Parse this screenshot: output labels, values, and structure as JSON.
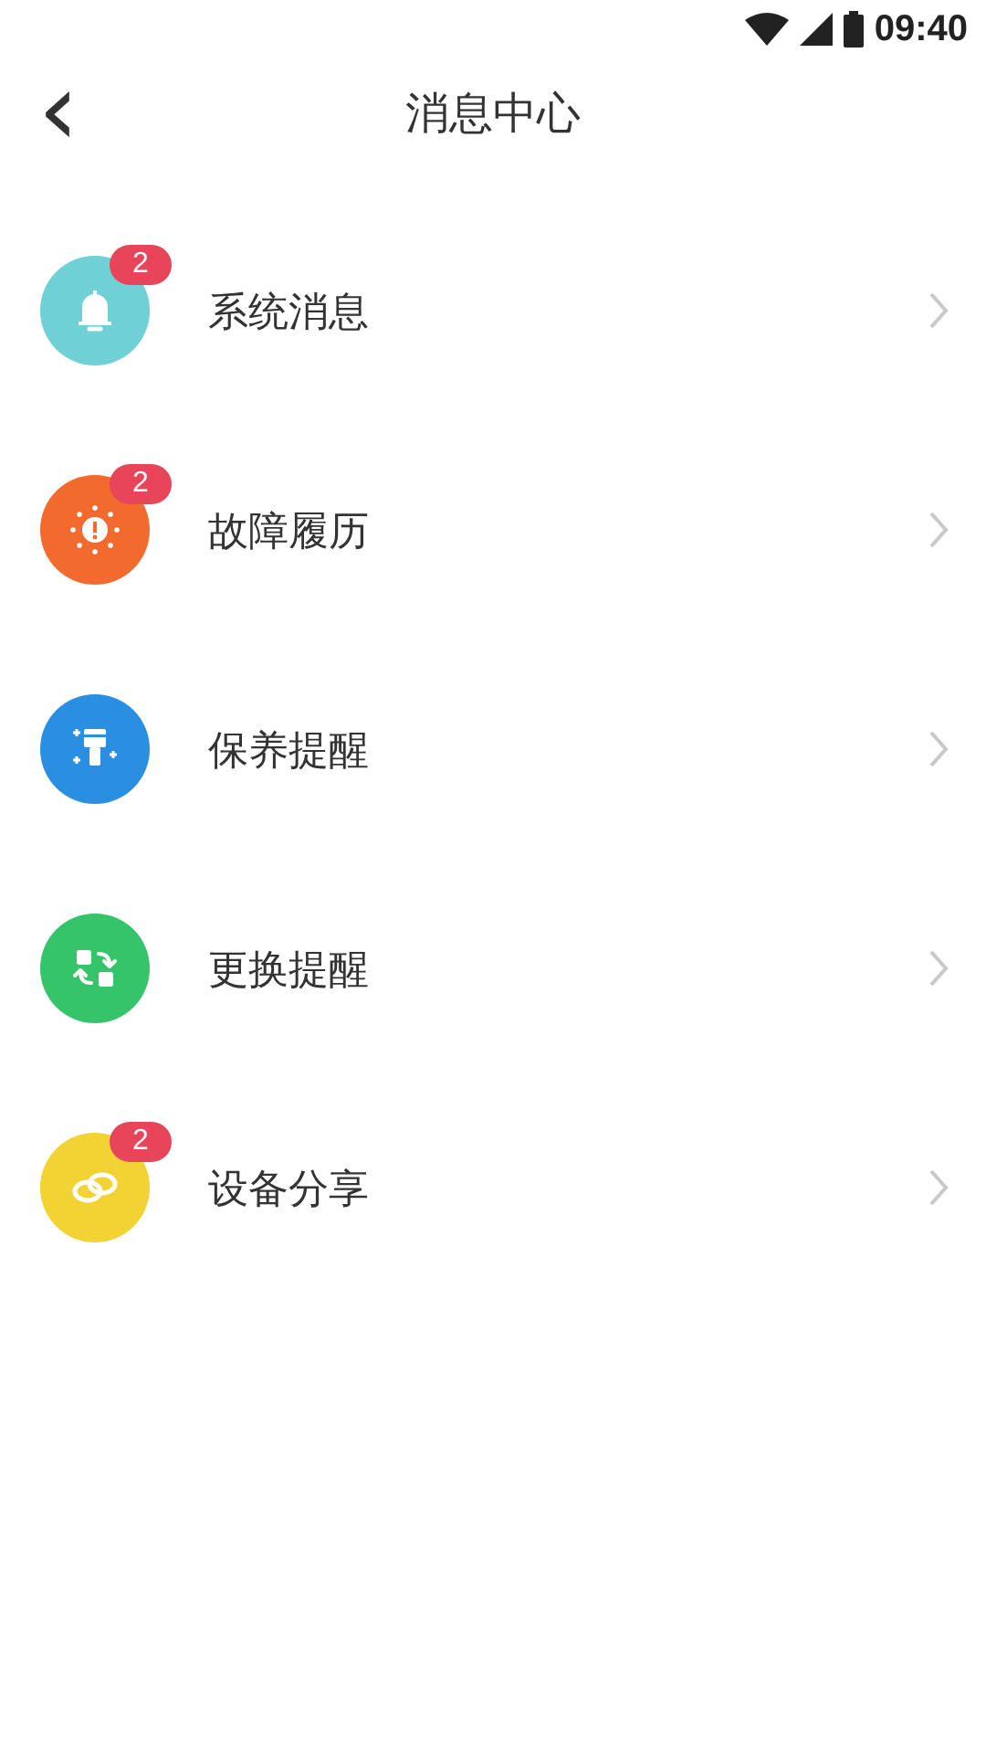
{
  "status_bar": {
    "time": "09:40"
  },
  "header": {
    "back": "‹",
    "title": "消息中心"
  },
  "items": [
    {
      "kind": "bell",
      "color": "#6fd0d6",
      "label": "系统消息",
      "badge": "2"
    },
    {
      "kind": "alert",
      "color": "#f26a2e",
      "label": "故障履历",
      "badge": "2"
    },
    {
      "kind": "brush",
      "color": "#2a8fe0",
      "label": "保养提醒"
    },
    {
      "kind": "swap",
      "color": "#35c46a",
      "label": "更换提醒"
    },
    {
      "kind": "link",
      "color": "#f3d233",
      "label": "设备分享",
      "badge": "2"
    }
  ]
}
